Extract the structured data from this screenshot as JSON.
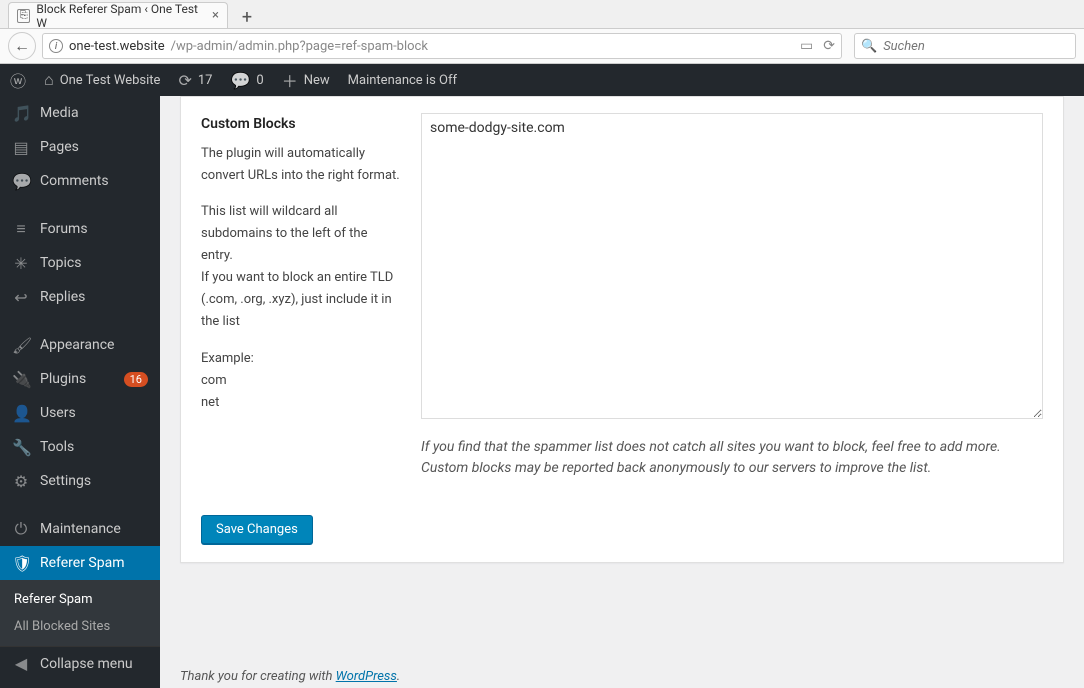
{
  "browser": {
    "tab_title": "Block Referer Spam ‹ One Test W",
    "url_host": "one-test.website",
    "url_path": "/wp-admin/admin.php?page=ref-spam-block",
    "search_placeholder": "Suchen"
  },
  "adminbar": {
    "site_name": "One Test Website",
    "updates_count": "17",
    "comments_count": "0",
    "new_label": "New",
    "maintenance_label": "Maintenance is Off"
  },
  "sidebar": {
    "media": "Media",
    "pages": "Pages",
    "comments": "Comments",
    "forums": "Forums",
    "topics": "Topics",
    "replies": "Replies",
    "appearance": "Appearance",
    "plugins": "Plugins",
    "plugins_badge": "16",
    "users": "Users",
    "tools": "Tools",
    "settings": "Settings",
    "maintenance": "Maintenance",
    "referer_spam": "Referer Spam",
    "sub_referer_spam": "Referer Spam",
    "sub_all_blocked": "All Blocked Sites",
    "collapse": "Collapse menu"
  },
  "panel": {
    "heading": "Custom Blocks",
    "desc1": "The plugin will automatically convert URLs into the right format.",
    "desc2": "This list will wildcard all subdomains to the left of the entry.",
    "desc3": "If you want to block an entire TLD (.com, .org, .xyz), just include it in the list",
    "example_label": "Example:",
    "example1": "com",
    "example2": "net",
    "textarea_value": "some-dodgy-site.com",
    "help": "If you find that the spammer list does not catch all sites you want to block, feel free to add more. Custom blocks may be reported back anonymously to our servers to improve the list.",
    "save_label": "Save Changes"
  },
  "footer": {
    "prefix": "Thank you for creating with ",
    "link": "WordPress",
    "suffix": "."
  }
}
